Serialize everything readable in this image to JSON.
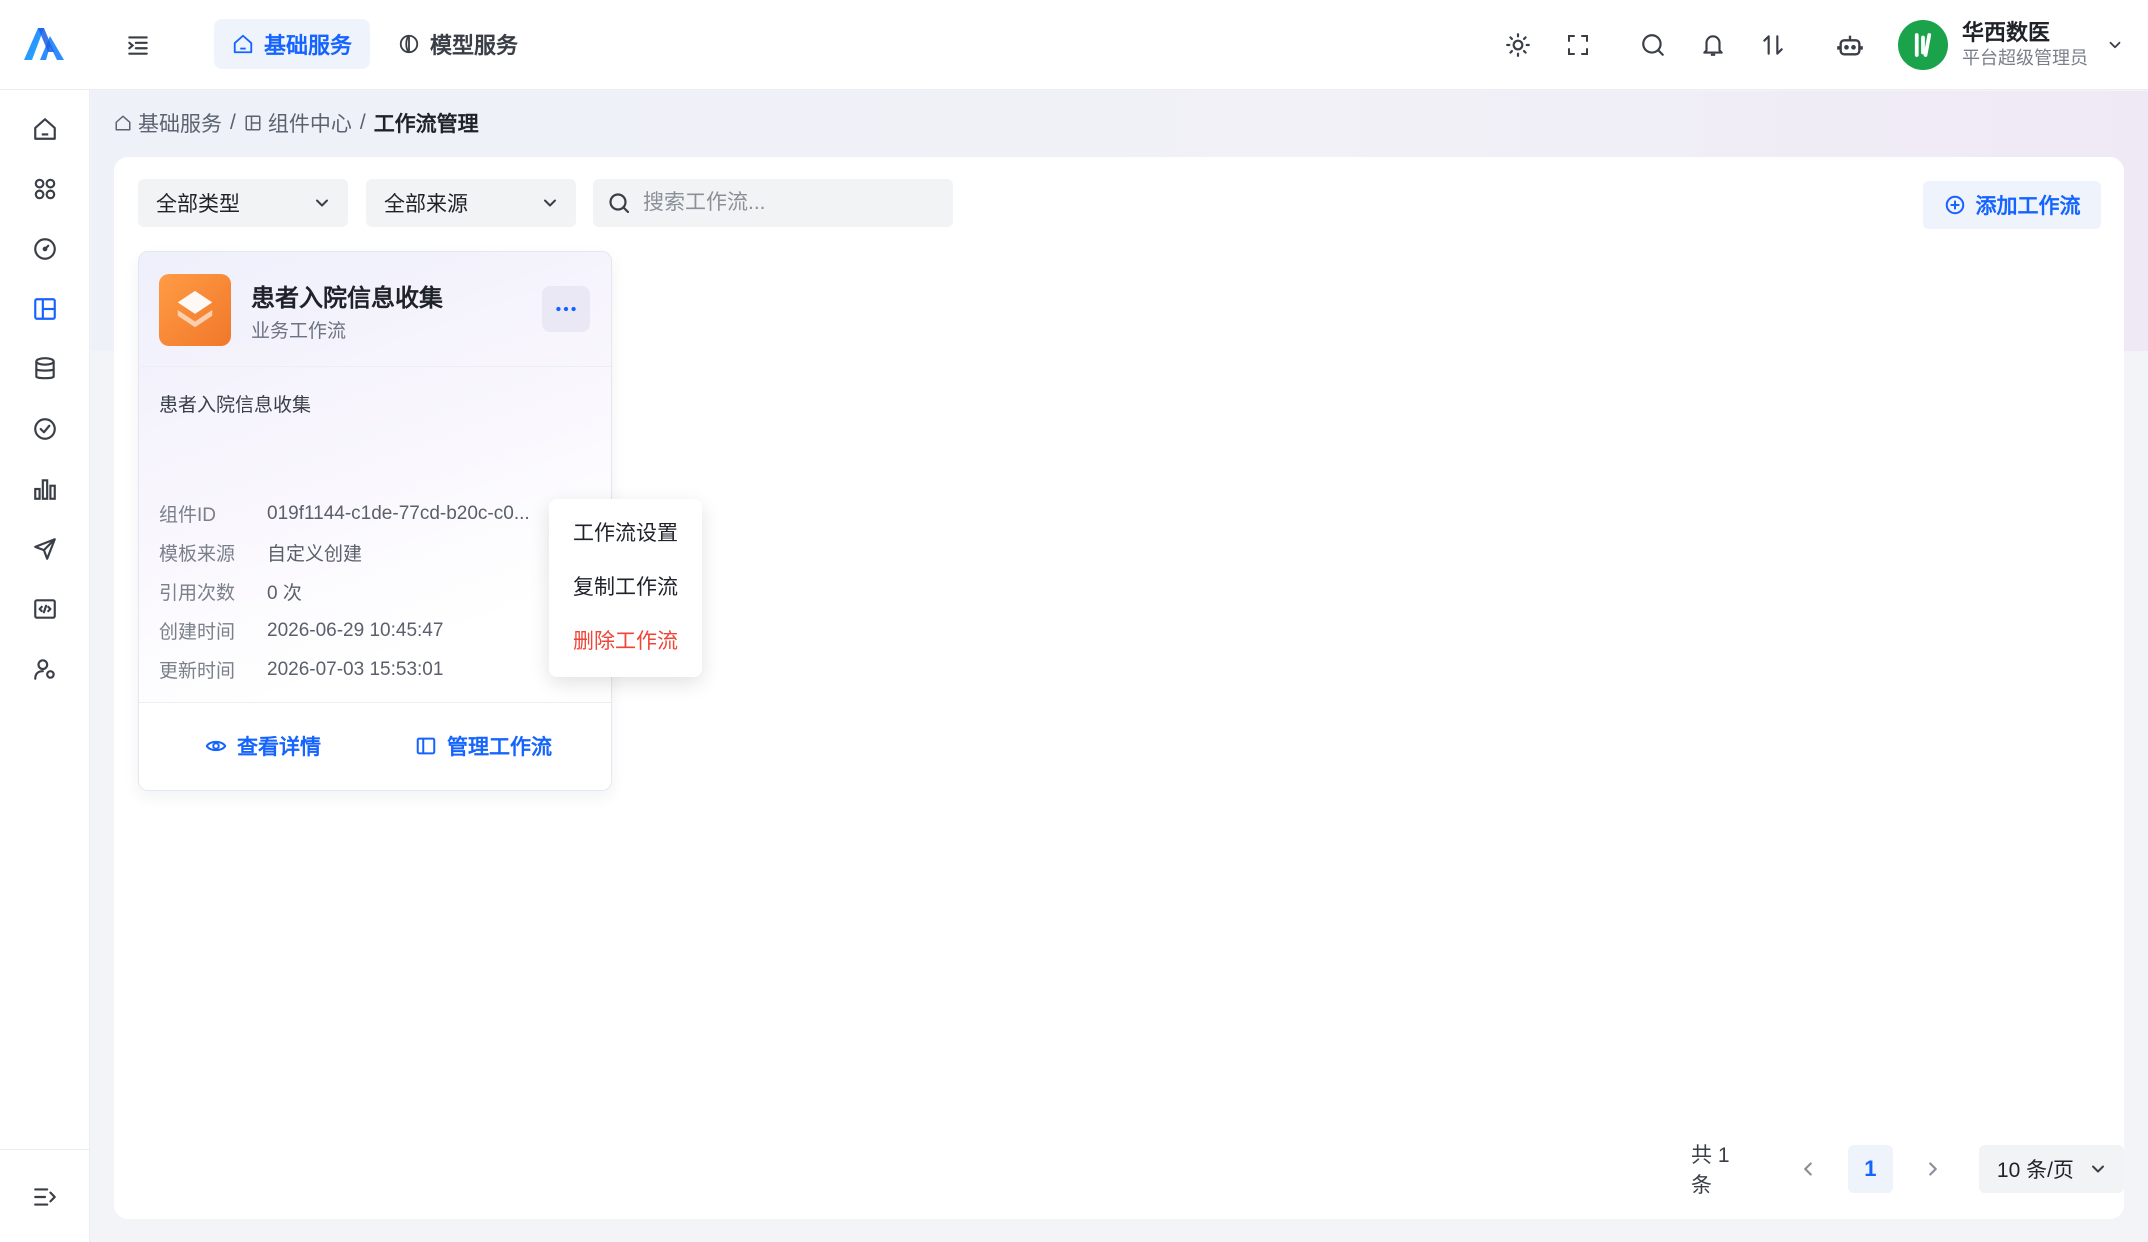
{
  "topbar": {
    "tabs": [
      {
        "label": "基础服务",
        "active": true
      },
      {
        "label": "模型服务",
        "active": false
      }
    ],
    "user": {
      "name": "华西数医",
      "role": "平台超级管理员"
    },
    "icons": [
      "sun-icon",
      "fullscreen-icon",
      "search-icon",
      "bell-icon",
      "sort-icon",
      "robot-icon"
    ]
  },
  "sidebar": {
    "items": [
      "home-icon",
      "apps-icon",
      "gauge-icon",
      "layout-icon",
      "database-icon",
      "check-circle-icon",
      "bar-chart-icon",
      "send-icon",
      "code-icon",
      "user-settings-icon"
    ],
    "active_index": 3
  },
  "breadcrumb": {
    "items": [
      "基础服务",
      "组件中心"
    ],
    "current": "工作流管理",
    "separator": "/"
  },
  "filters": {
    "type_select": "全部类型",
    "source_select": "全部来源",
    "search_placeholder": "搜索工作流...",
    "add_button": "添加工作流"
  },
  "workflow_card": {
    "title": "患者入院信息收集",
    "type": "业务工作流",
    "description": "患者入院信息收集",
    "meta": [
      {
        "label": "组件ID",
        "value": "019f1144-c1de-77cd-b20c-c0..."
      },
      {
        "label": "模板来源",
        "value": "自定义创建"
      },
      {
        "label": "引用次数",
        "value": "0 次"
      },
      {
        "label": "创建时间",
        "value": "2026-06-29 10:45:47"
      },
      {
        "label": "更新时间",
        "value": "2026-07-03 15:53:01"
      }
    ],
    "view_button": "查看详情",
    "manage_button": "管理工作流"
  },
  "context_menu": {
    "items": [
      {
        "label": "工作流设置"
      },
      {
        "label": "复制工作流"
      },
      {
        "label": "删除工作流",
        "danger": true
      }
    ]
  },
  "pagination": {
    "total": "共 1 条",
    "current_page": "1",
    "page_size": "10 条/页"
  },
  "colors": {
    "primary": "#1664ff",
    "danger": "#f04438",
    "card_logo": "#f0782a",
    "avatar": "#1aa34a"
  }
}
